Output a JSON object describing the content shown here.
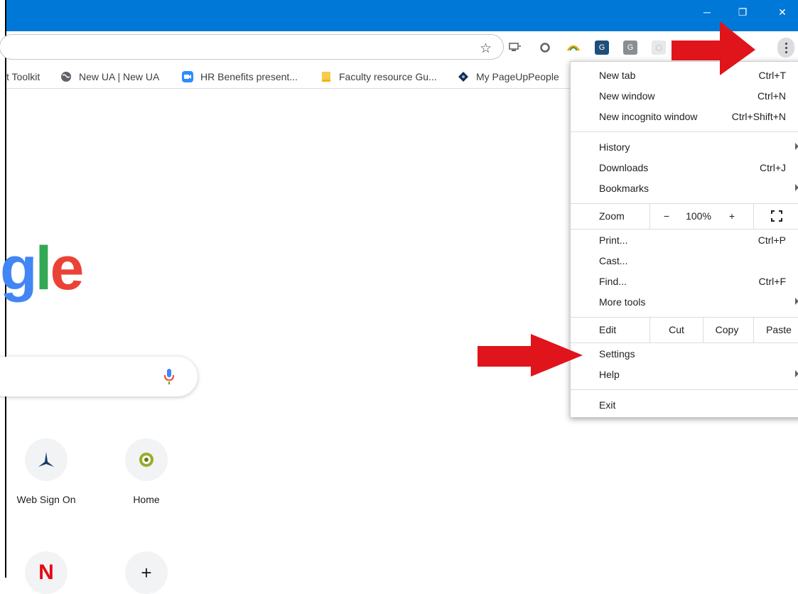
{
  "window_controls": {
    "minimize": "─",
    "restore": "❐",
    "close": "✕"
  },
  "bookmarks": [
    {
      "label": "t Toolkit"
    },
    {
      "label": "New UA | New UA"
    },
    {
      "label": "HR Benefits present..."
    },
    {
      "label": "Faculty resource Gu..."
    },
    {
      "label": "My PageUpPeople"
    }
  ],
  "logo": {
    "text": "gle"
  },
  "shortcuts": [
    {
      "label": "Web Sign On"
    },
    {
      "label": "Home"
    },
    {
      "label": ""
    },
    {
      "label": ""
    }
  ],
  "menu": {
    "new_tab": {
      "label": "New tab",
      "shortcut": "Ctrl+T"
    },
    "new_window": {
      "label": "New window",
      "shortcut": "Ctrl+N"
    },
    "new_incognito": {
      "label": "New incognito window",
      "shortcut": "Ctrl+Shift+N"
    },
    "history": {
      "label": "History"
    },
    "downloads": {
      "label": "Downloads",
      "shortcut": "Ctrl+J"
    },
    "bookmarks": {
      "label": "Bookmarks"
    },
    "zoom": {
      "label": "Zoom",
      "minus": "−",
      "value": "100%",
      "plus": "+"
    },
    "print": {
      "label": "Print...",
      "shortcut": "Ctrl+P"
    },
    "cast": {
      "label": "Cast..."
    },
    "find": {
      "label": "Find...",
      "shortcut": "Ctrl+F"
    },
    "more_tools": {
      "label": "More tools"
    },
    "edit": {
      "label": "Edit",
      "cut": "Cut",
      "copy": "Copy",
      "paste": "Paste"
    },
    "settings": {
      "label": "Settings"
    },
    "help": {
      "label": "Help"
    },
    "exit": {
      "label": "Exit"
    }
  },
  "colors": {
    "titlebar": "#0078d7",
    "annotation_arrow": "#e0141b",
    "google_blue": "#4285f4",
    "google_green": "#34a853",
    "google_red": "#ea4335"
  }
}
